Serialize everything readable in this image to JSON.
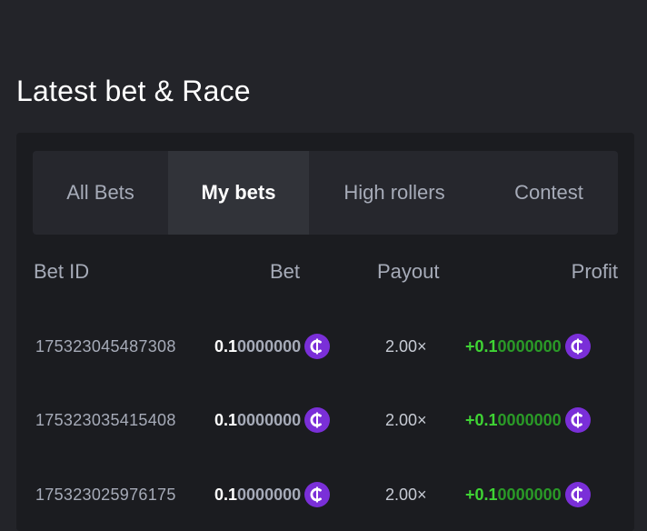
{
  "section": {
    "title": "Latest bet & Race"
  },
  "tabs": [
    {
      "label": "All Bets",
      "active": false
    },
    {
      "label": "My bets",
      "active": true
    },
    {
      "label": "High rollers",
      "active": false
    },
    {
      "label": "Contest",
      "active": false
    }
  ],
  "table": {
    "headers": {
      "bet_id": "Bet ID",
      "bet": "Bet",
      "payout": "Payout",
      "profit": "Profit"
    },
    "rows": [
      {
        "bet_id": "175323045487308",
        "bet_lead": "0.1",
        "bet_trail": "0000000",
        "payout": "2.00×",
        "profit_lead": "+0.1",
        "profit_trail": "0000000",
        "currency_icon": "coin-icon"
      },
      {
        "bet_id": "175323035415408",
        "bet_lead": "0.1",
        "bet_trail": "0000000",
        "payout": "2.00×",
        "profit_lead": "+0.1",
        "profit_trail": "0000000",
        "currency_icon": "coin-icon"
      },
      {
        "bet_id": "175323025976175",
        "bet_lead": "0.1",
        "bet_trail": "0000000",
        "payout": "2.00×",
        "profit_lead": "+0.1",
        "profit_trail": "0000000",
        "currency_icon": "coin-icon"
      }
    ]
  },
  "colors": {
    "background": "#232429",
    "panel": "#1b1c20",
    "profit_green": "#3fd434",
    "coin_purple": "#7a2fd8"
  }
}
